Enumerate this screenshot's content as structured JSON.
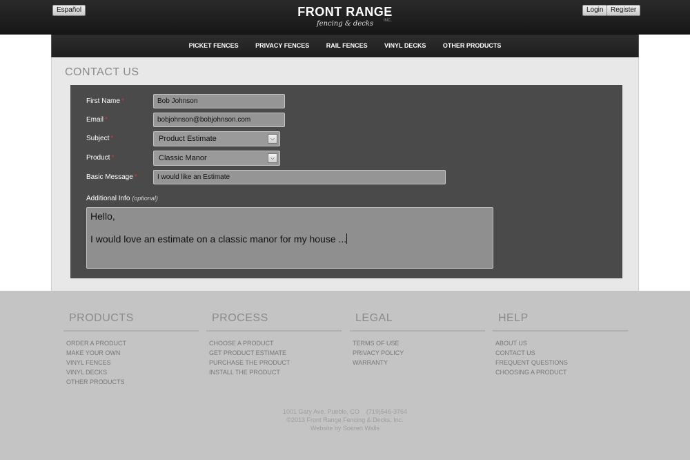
{
  "header": {
    "language_button": "Español",
    "login_button": "Login",
    "register_button": "Register",
    "logo_main": "FRONT RANGE",
    "logo_sub": "fencing & decks",
    "logo_inc": "INC."
  },
  "nav": {
    "items": [
      "PICKET FENCES",
      "PRIVACY FENCES",
      "RAIL FENCES",
      "VINYL DECKS",
      "OTHER PRODUCTS"
    ]
  },
  "page": {
    "title": "CONTACT US"
  },
  "form": {
    "required_marker": "*",
    "first_name": {
      "label": "First Name",
      "value": "Bob Johnson"
    },
    "email": {
      "label": "Email",
      "value": "bobjohnson@bobjohnson.com"
    },
    "subject": {
      "label": "Subject",
      "value": "Product Estimate"
    },
    "product": {
      "label": "Product",
      "value": "Classic Manor"
    },
    "basic_message": {
      "label": "Basic Message",
      "value": "I would like an Estimate"
    },
    "additional_info": {
      "label": "Additional Info",
      "optional_note": "(optional)",
      "line1": "Hello,",
      "line2": "I would love an estimate on a classic manor for my house ..."
    }
  },
  "footer": {
    "columns": [
      {
        "title": "PRODUCTS",
        "links": [
          "ORDER A PRODUCT",
          "MAKE YOUR OWN",
          "VINYL FENCES",
          "VINYL DECKS",
          "OTHER PRODUCTS"
        ]
      },
      {
        "title": "PROCESS",
        "links": [
          "CHOOSE A PRODUCT",
          "GET PRODUCT ESTIMATE",
          "PURCHASE THE PRODUCT",
          "INSTALL THE PRODUCT"
        ]
      },
      {
        "title": "LEGAL",
        "links": [
          "TERMS OF USE",
          "PRIVACY POLICY",
          "WARRANTY"
        ]
      },
      {
        "title": "HELP",
        "links": [
          "ABOUT US",
          "CONTACT US",
          "FREQUENT QUESTIONS",
          "CHOOSING A PRODUCT"
        ]
      }
    ],
    "address": "1001 Gary Ave. Pueblo, CO    (719)546-3764",
    "copyright": "©2013 Front Range Fencing & Decks, Inc.",
    "credit": "Website by Soeren Walls"
  }
}
